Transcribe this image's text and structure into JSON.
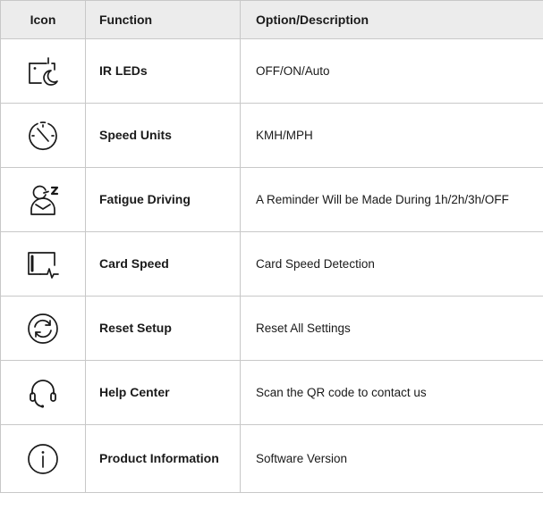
{
  "table": {
    "headers": {
      "icon": "Icon",
      "function": "Function",
      "description": "Option/Description"
    },
    "rows": [
      {
        "icon": "ir-night-camera-icon",
        "function": "IR LEDs",
        "description": "OFF/ON/Auto"
      },
      {
        "icon": "speedometer-icon",
        "function": "Speed Units",
        "description": "KMH/MPH"
      },
      {
        "icon": "fatigue-driver-icon",
        "function": "Fatigue Driving",
        "description": "A Reminder Will be Made During 1h/2h/3h/OFF"
      },
      {
        "icon": "card-pulse-icon",
        "function": "Card Speed",
        "description": "Card Speed Detection"
      },
      {
        "icon": "reset-cycle-icon",
        "function": "Reset Setup",
        "description": "Reset All Settings"
      },
      {
        "icon": "headset-icon",
        "function": "Help Center",
        "description": "Scan the QR code to contact us"
      },
      {
        "icon": "info-icon",
        "function": "Product Information",
        "description": "Software Version"
      }
    ]
  }
}
